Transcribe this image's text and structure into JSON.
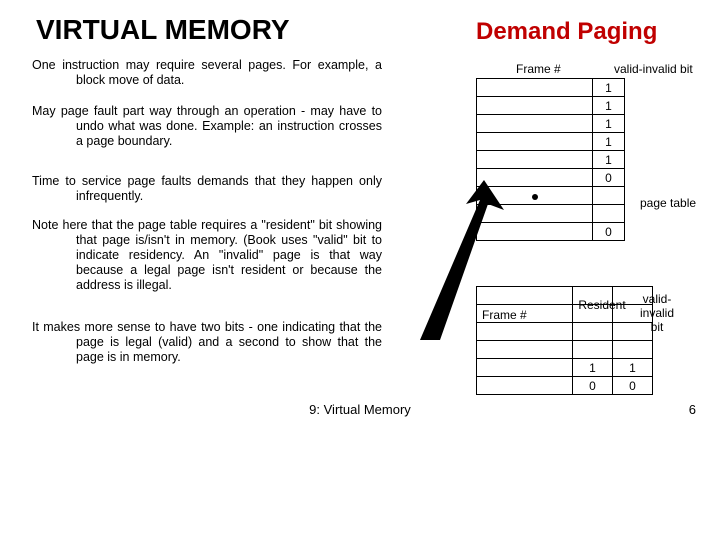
{
  "titles": {
    "left": "VIRTUAL MEMORY",
    "right": "Demand Paging"
  },
  "paragraphs": {
    "p1": "One instruction may require several pages. For example, a block move of data.",
    "p2": "May page fault part way through an operation - may have to undo what was done. Example: an instruction crosses a page boundary.",
    "p3": "Time to service page faults demands that they happen only infrequently.",
    "p4": "Note here that the page table requires a \"resident\" bit showing that page is/isn't in memory. (Book uses \"valid\" bit to indicate residency. An \"invalid\" page is that way because a legal page isn't resident or because the address is illegal.",
    "p5": "It makes more sense to have two bits - one indicating that the page is legal (valid) and a second to show that the page is in memory."
  },
  "footer": {
    "center": "9: Virtual Memory",
    "page": "6"
  },
  "diagram": {
    "labels": {
      "frame1": "Frame #",
      "valid1": "valid-invalid bit",
      "page_table": "page table",
      "frame2": "Frame #",
      "resident": "Resident",
      "valid2": "valid-invalid bit"
    },
    "table1_bits": [
      "1",
      "1",
      "1",
      "1",
      "1",
      "0",
      "",
      "",
      "0"
    ],
    "table2": {
      "rows_blank": 4,
      "rows_values": [
        {
          "resident": "1",
          "valid": "1"
        },
        {
          "resident": "0",
          "valid": "0"
        }
      ]
    }
  }
}
